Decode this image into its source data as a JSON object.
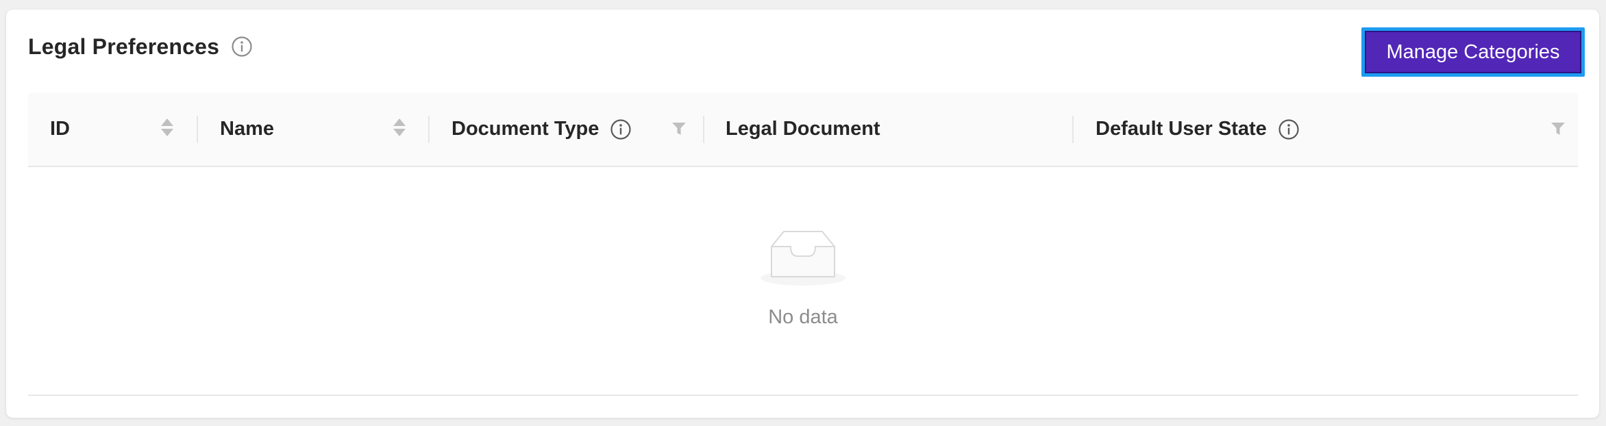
{
  "section": {
    "title": "Legal Preferences"
  },
  "actions": {
    "manage_categories_label": "Manage Categories"
  },
  "table": {
    "columns": [
      {
        "label": "ID",
        "sortable": true
      },
      {
        "label": "Name",
        "sortable": true
      },
      {
        "label": "Document Type",
        "info": true,
        "filterable": true
      },
      {
        "label": "Legal Document"
      },
      {
        "label": "Default User State",
        "info": true,
        "filterable": true
      }
    ],
    "rows": [],
    "empty_text": "No data"
  },
  "colors": {
    "primary_button": "#5226b7",
    "focus_ring": "#1d9bf0",
    "header_bg": "#fafafa",
    "muted_text": "#8c8c8c"
  },
  "icons": [
    "info-icon",
    "sort-icon",
    "filter-icon",
    "empty-inbox-icon"
  ]
}
